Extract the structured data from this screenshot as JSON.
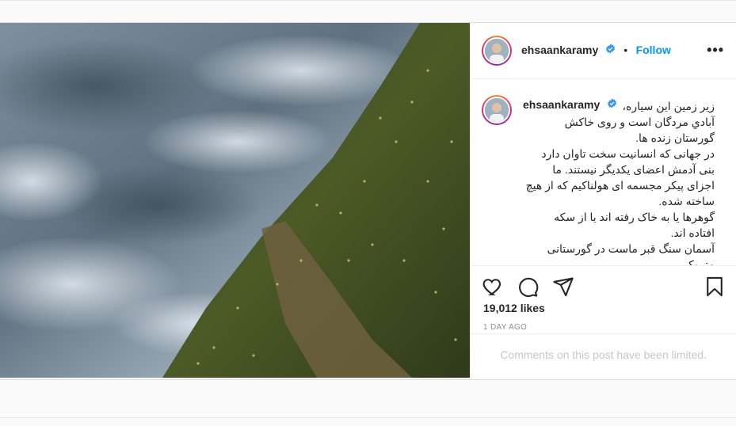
{
  "post": {
    "username": "ehsaankaramy",
    "follow_label": "Follow",
    "dot": "•",
    "more_label": "•••",
    "caption": "زیر زمین این سیاره،\nآبادیِ مردگان است و روی خاکش\nگورستان زنده ها.\nدر جهانی که انسانیت سخت تاوان دارد\nبنی آدمش اعضای یکدیگر نیستند. ما\nاجزای پیکر مجسمه ای هولناکیم که از هیچ\nساخته شده.\nگوهرها یا به خاک رفته اند یا از سکه\nافتاده اند.\nآسمان سنگ قبر ماست در گورستانی\nمتروک .\nکاش کمی سهم داشتیم",
    "likes": "19,012 likes",
    "time": "1 DAY AGO",
    "comments_limited": "Comments on this post have been limited."
  },
  "icons": {
    "like": "heart-icon",
    "comment": "comment-icon",
    "share": "share-icon",
    "save": "bookmark-icon",
    "verified": "verified-badge-icon",
    "more": "more-options-icon"
  },
  "colors": {
    "accent": "#0095f6",
    "text": "#262626",
    "muted": "#8e8e8e",
    "limited": "#c7c7c7"
  }
}
